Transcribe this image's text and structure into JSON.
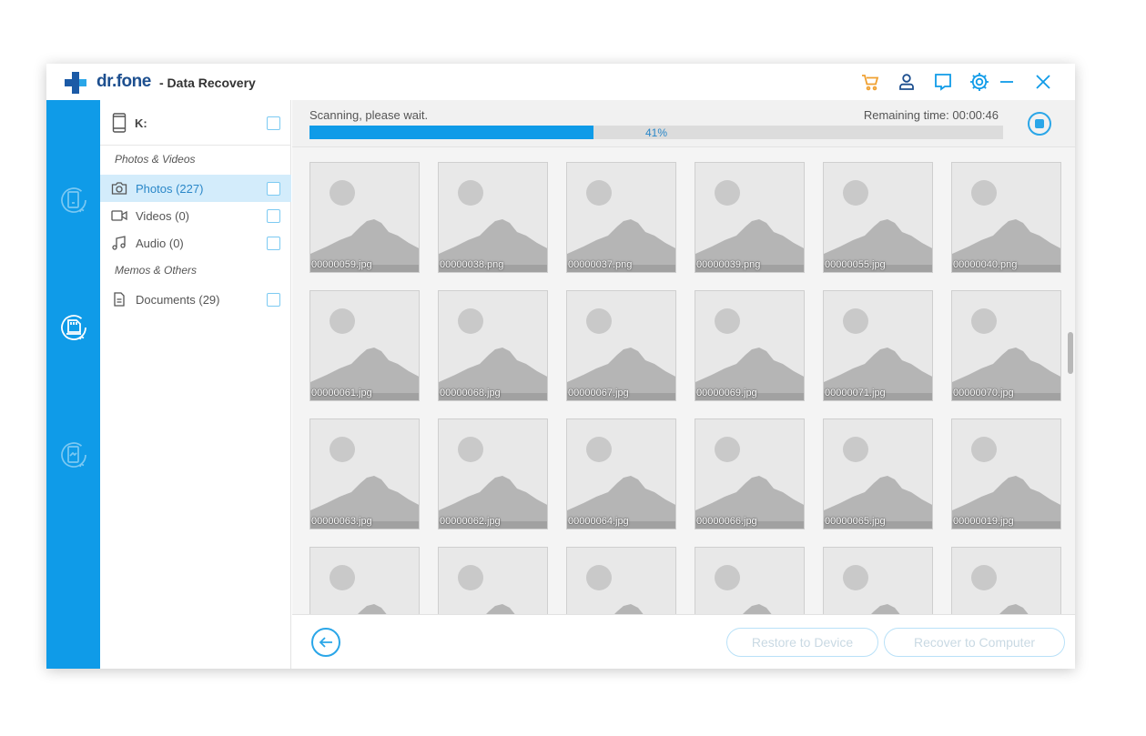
{
  "app": {
    "brand": "dr.fone",
    "title": "- Data Recovery"
  },
  "titlebar_icons": [
    "cart-icon",
    "account-icon",
    "feedback-icon",
    "settings-icon",
    "minimize-icon",
    "close-icon"
  ],
  "colors": {
    "accent": "#0f9be8",
    "cart": "#f0a030",
    "rail": "#0f9be8",
    "active_row": "#d3ecfb"
  },
  "rail": {
    "items": [
      "phone-recovery-icon",
      "sd-card-recovery-icon",
      "backup-recovery-icon"
    ],
    "active_index": 1
  },
  "sidebar": {
    "drive_label": "K:",
    "sections": [
      {
        "title": "Photos & Videos",
        "items": [
          {
            "label": "Photos (227)",
            "icon": "camera-icon",
            "active": true
          },
          {
            "label": "Videos (0)",
            "icon": "video-icon",
            "active": false
          },
          {
            "label": "Audio (0)",
            "icon": "music-icon",
            "active": false
          }
        ]
      },
      {
        "title": "Memos & Others",
        "items": [
          {
            "label": "Documents (29)",
            "icon": "document-icon",
            "active": false
          }
        ]
      }
    ]
  },
  "scan": {
    "status": "Scanning, please wait.",
    "remaining": "Remaining time: 00:00:46",
    "progress_percent": 41,
    "progress_label": "41%"
  },
  "thumbnails": [
    "00000059.jpg",
    "00000038.png",
    "00000037.png",
    "00000039.png",
    "00000055.jpg",
    "00000040.png",
    "00000061.jpg",
    "00000068.jpg",
    "00000067.jpg",
    "00000069.jpg",
    "00000071.jpg",
    "00000070.jpg",
    "00000063.jpg",
    "00000062.jpg",
    "00000064.jpg",
    "00000066.jpg",
    "00000065.jpg",
    "00000019.jpg",
    "",
    "",
    "",
    "",
    "",
    ""
  ],
  "footer": {
    "restore_label": "Restore to Device",
    "recover_label": "Recover to Computer"
  }
}
